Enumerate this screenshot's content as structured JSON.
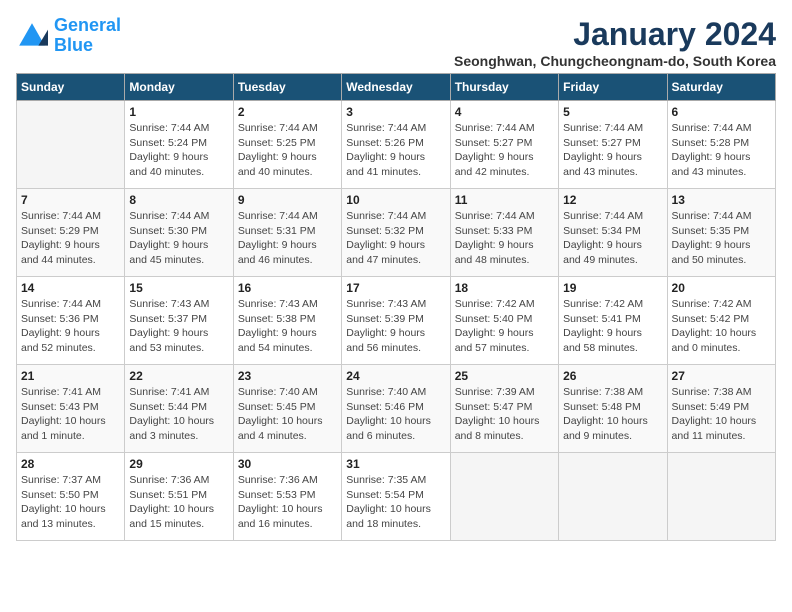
{
  "header": {
    "logo_line1": "General",
    "logo_line2": "Blue",
    "month_title": "January 2024",
    "subtitle": "Seonghwan, Chungcheongnam-do, South Korea"
  },
  "weekdays": [
    "Sunday",
    "Monday",
    "Tuesday",
    "Wednesday",
    "Thursday",
    "Friday",
    "Saturday"
  ],
  "weeks": [
    [
      {
        "day": "",
        "info": ""
      },
      {
        "day": "1",
        "info": "Sunrise: 7:44 AM\nSunset: 5:24 PM\nDaylight: 9 hours\nand 40 minutes."
      },
      {
        "day": "2",
        "info": "Sunrise: 7:44 AM\nSunset: 5:25 PM\nDaylight: 9 hours\nand 40 minutes."
      },
      {
        "day": "3",
        "info": "Sunrise: 7:44 AM\nSunset: 5:26 PM\nDaylight: 9 hours\nand 41 minutes."
      },
      {
        "day": "4",
        "info": "Sunrise: 7:44 AM\nSunset: 5:27 PM\nDaylight: 9 hours\nand 42 minutes."
      },
      {
        "day": "5",
        "info": "Sunrise: 7:44 AM\nSunset: 5:27 PM\nDaylight: 9 hours\nand 43 minutes."
      },
      {
        "day": "6",
        "info": "Sunrise: 7:44 AM\nSunset: 5:28 PM\nDaylight: 9 hours\nand 43 minutes."
      }
    ],
    [
      {
        "day": "7",
        "info": "Sunrise: 7:44 AM\nSunset: 5:29 PM\nDaylight: 9 hours\nand 44 minutes."
      },
      {
        "day": "8",
        "info": "Sunrise: 7:44 AM\nSunset: 5:30 PM\nDaylight: 9 hours\nand 45 minutes."
      },
      {
        "day": "9",
        "info": "Sunrise: 7:44 AM\nSunset: 5:31 PM\nDaylight: 9 hours\nand 46 minutes."
      },
      {
        "day": "10",
        "info": "Sunrise: 7:44 AM\nSunset: 5:32 PM\nDaylight: 9 hours\nand 47 minutes."
      },
      {
        "day": "11",
        "info": "Sunrise: 7:44 AM\nSunset: 5:33 PM\nDaylight: 9 hours\nand 48 minutes."
      },
      {
        "day": "12",
        "info": "Sunrise: 7:44 AM\nSunset: 5:34 PM\nDaylight: 9 hours\nand 49 minutes."
      },
      {
        "day": "13",
        "info": "Sunrise: 7:44 AM\nSunset: 5:35 PM\nDaylight: 9 hours\nand 50 minutes."
      }
    ],
    [
      {
        "day": "14",
        "info": "Sunrise: 7:44 AM\nSunset: 5:36 PM\nDaylight: 9 hours\nand 52 minutes."
      },
      {
        "day": "15",
        "info": "Sunrise: 7:43 AM\nSunset: 5:37 PM\nDaylight: 9 hours\nand 53 minutes."
      },
      {
        "day": "16",
        "info": "Sunrise: 7:43 AM\nSunset: 5:38 PM\nDaylight: 9 hours\nand 54 minutes."
      },
      {
        "day": "17",
        "info": "Sunrise: 7:43 AM\nSunset: 5:39 PM\nDaylight: 9 hours\nand 56 minutes."
      },
      {
        "day": "18",
        "info": "Sunrise: 7:42 AM\nSunset: 5:40 PM\nDaylight: 9 hours\nand 57 minutes."
      },
      {
        "day": "19",
        "info": "Sunrise: 7:42 AM\nSunset: 5:41 PM\nDaylight: 9 hours\nand 58 minutes."
      },
      {
        "day": "20",
        "info": "Sunrise: 7:42 AM\nSunset: 5:42 PM\nDaylight: 10 hours\nand 0 minutes."
      }
    ],
    [
      {
        "day": "21",
        "info": "Sunrise: 7:41 AM\nSunset: 5:43 PM\nDaylight: 10 hours\nand 1 minute."
      },
      {
        "day": "22",
        "info": "Sunrise: 7:41 AM\nSunset: 5:44 PM\nDaylight: 10 hours\nand 3 minutes."
      },
      {
        "day": "23",
        "info": "Sunrise: 7:40 AM\nSunset: 5:45 PM\nDaylight: 10 hours\nand 4 minutes."
      },
      {
        "day": "24",
        "info": "Sunrise: 7:40 AM\nSunset: 5:46 PM\nDaylight: 10 hours\nand 6 minutes."
      },
      {
        "day": "25",
        "info": "Sunrise: 7:39 AM\nSunset: 5:47 PM\nDaylight: 10 hours\nand 8 minutes."
      },
      {
        "day": "26",
        "info": "Sunrise: 7:38 AM\nSunset: 5:48 PM\nDaylight: 10 hours\nand 9 minutes."
      },
      {
        "day": "27",
        "info": "Sunrise: 7:38 AM\nSunset: 5:49 PM\nDaylight: 10 hours\nand 11 minutes."
      }
    ],
    [
      {
        "day": "28",
        "info": "Sunrise: 7:37 AM\nSunset: 5:50 PM\nDaylight: 10 hours\nand 13 minutes."
      },
      {
        "day": "29",
        "info": "Sunrise: 7:36 AM\nSunset: 5:51 PM\nDaylight: 10 hours\nand 15 minutes."
      },
      {
        "day": "30",
        "info": "Sunrise: 7:36 AM\nSunset: 5:53 PM\nDaylight: 10 hours\nand 16 minutes."
      },
      {
        "day": "31",
        "info": "Sunrise: 7:35 AM\nSunset: 5:54 PM\nDaylight: 10 hours\nand 18 minutes."
      },
      {
        "day": "",
        "info": ""
      },
      {
        "day": "",
        "info": ""
      },
      {
        "day": "",
        "info": ""
      }
    ]
  ]
}
